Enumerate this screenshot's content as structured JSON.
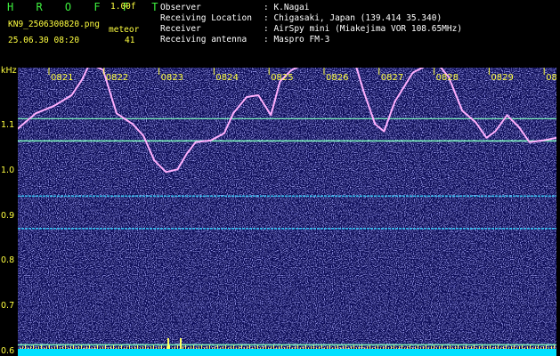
{
  "header": {
    "brand": "H R O F F T",
    "version": "1.00f",
    "filename": "KN9_2506300820.png",
    "datetime": "25.06.30 08:20",
    "counter_label": "meteor",
    "counter_value": "41",
    "info_rows": [
      {
        "label": "Observer",
        "value": ": K.Nagai"
      },
      {
        "label": "Receiving Location",
        "value": ": Chigasaki, Japan (139.414 35.340)"
      },
      {
        "label": "Receiver",
        "value": ": AirSpy mini (Miakejima VOR 108.65MHz)"
      },
      {
        "label": "Receiving antenna",
        "value": ": Maspro FM-3"
      }
    ]
  },
  "chart_data": {
    "type": "heatmap",
    "title": "",
    "ylabel": "kHz",
    "ylim": [
      0.58,
      1.24
    ],
    "time_ticks": [
      "0821",
      "0822",
      "0823",
      "0824",
      "0825",
      "0826",
      "0827",
      "0828",
      "0829",
      "0830"
    ],
    "y_ticks": [
      "1.1",
      "1.0",
      "0.9",
      "0.8",
      "0.7",
      "0.6"
    ],
    "y_tick_values": [
      1.1,
      1.0,
      0.9,
      0.8,
      0.7,
      0.6
    ],
    "horizontal_lines_khz": [
      1.115,
      1.066,
      0.944,
      0.872,
      0.615
    ],
    "colors": {
      "background": "#0a0a5a",
      "trace": "#ffb0ff",
      "line": "#80ffc0",
      "axis_text": "#ffff40",
      "bottom_strip": "#00e0ff"
    }
  }
}
